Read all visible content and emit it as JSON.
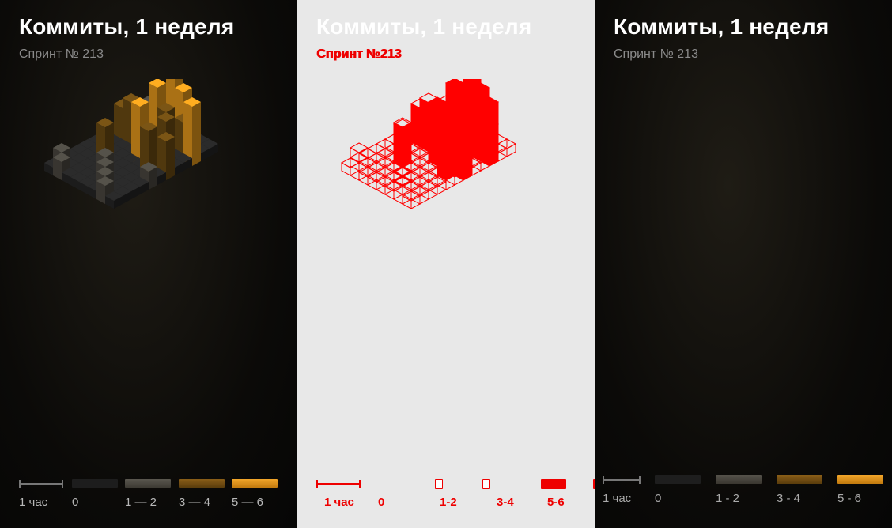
{
  "panels": [
    {
      "title": "Коммиты, 1 неделя",
      "subtitle": "Спринт № 213",
      "legend": {
        "scale_label": "1 час",
        "items": [
          "0",
          "1 — 2",
          "3 — 4",
          "5 — 6"
        ]
      }
    },
    {
      "title": "Коммиты, 1 неделя",
      "subtitle": "Спринт №213",
      "legend": {
        "scale_label": "1 час",
        "items": [
          "0",
          "1-2",
          "3-4",
          "5-6"
        ]
      }
    },
    {
      "title": "Коммиты, 1 неделя",
      "subtitle": "Спринт № 213",
      "legend": {
        "scale_label": "1 час",
        "items": [
          "0",
          "1 - 2",
          "3 - 4",
          "5 - 6"
        ]
      }
    }
  ],
  "colors": {
    "level0": "#252525",
    "level1": "#4a4740",
    "level2": "#6b4a12",
    "level3": "#e2961c",
    "edge_red": "#ff0000",
    "mid_bg": "#e8e8e8"
  },
  "tall_bars": [
    {
      "x": 4,
      "y": 1,
      "value": 6
    },
    {
      "x": 5,
      "y": 1,
      "value": 5
    },
    {
      "x": 3,
      "y": 2,
      "value": 5
    },
    {
      "x": 5,
      "y": 3,
      "value": 4
    },
    {
      "x": 7,
      "y": 2,
      "value": 5
    },
    {
      "x": 8,
      "y": 3,
      "value": 4
    },
    {
      "x": 6,
      "y": 4,
      "value": 4
    },
    {
      "x": 4,
      "y": 5,
      "value": 5
    },
    {
      "x": 2,
      "y": 4,
      "value": 4
    },
    {
      "x": 1,
      "y": 4,
      "value": 3
    },
    {
      "x": 6,
      "y": 6,
      "value": 4
    },
    {
      "x": 7,
      "y": 5,
      "value": 3
    },
    {
      "x": 9,
      "y": 4,
      "value": 3
    },
    {
      "x": 2,
      "y": 7,
      "value": 3
    },
    {
      "x": 6,
      "y": 2,
      "value": 3
    }
  ]
}
